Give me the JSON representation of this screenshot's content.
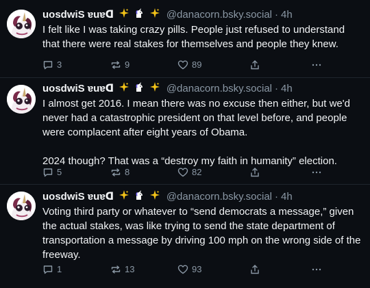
{
  "posts": [
    {
      "author": {
        "display_name": "uosdwiS ɐuɐᗡ",
        "handle": "@danacorn.bsky.social",
        "emojis": [
          "sparkles-icon",
          "unicorn-icon",
          "sparkles-icon"
        ]
      },
      "time": "4h",
      "body": [
        "I felt like I was taking crazy pills. People just refused to understand that there were real stakes for themselves and people they knew."
      ],
      "replies": "3",
      "reposts": "9",
      "likes": "89"
    },
    {
      "author": {
        "display_name": "uosdwiS ɐuɐᗡ",
        "handle": "@danacorn.bsky.social",
        "emojis": [
          "sparkles-icon",
          "unicorn-icon",
          "sparkles-icon"
        ]
      },
      "time": "4h",
      "body": [
        "I almost get 2016. I mean there was no excuse then either, but we'd never had a catastrophic president on that level before, and people were complacent after eight years of Obama.",
        "2024 though? That was a “destroy my faith in humanity” election."
      ],
      "replies": "5",
      "reposts": "8",
      "likes": "82"
    },
    {
      "author": {
        "display_name": "uosdwiS ɐuɐᗡ",
        "handle": "@danacorn.bsky.social",
        "emojis": [
          "sparkles-icon",
          "unicorn-icon",
          "sparkles-icon"
        ]
      },
      "time": "4h",
      "body": [
        "Voting third party or whatever to “send democrats a message,” given the actual stakes, was like trying to send the state department of transportation a message by driving 100 mph on the wrong side of the freeway."
      ],
      "replies": "1",
      "reposts": "13",
      "likes": "93"
    }
  ],
  "colors": {
    "background": "#0b0e13",
    "text": "#f1f3f5",
    "muted": "#8b98a5",
    "divider": "#1f252d"
  }
}
